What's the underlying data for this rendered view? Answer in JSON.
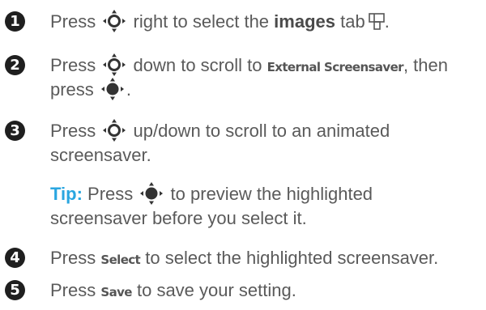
{
  "steps": [
    {
      "number": "1",
      "parts": {
        "a": "Press",
        "b": "right to select the",
        "c": "images",
        "d": "tab",
        "e": "."
      }
    },
    {
      "number": "2",
      "parts": {
        "a": "Press",
        "b": "down to scroll to",
        "c": "External Screensaver",
        "d": ", then",
        "e": "press",
        "f": "."
      }
    },
    {
      "number": "3",
      "parts": {
        "a": "Press",
        "b": "up/down to scroll to an animated",
        "c": "screensaver."
      }
    },
    {
      "number": "4",
      "parts": {
        "a": "Press",
        "b": "Select",
        "c": "to select the highlighted screensaver."
      }
    },
    {
      "number": "5",
      "parts": {
        "a": "Press",
        "b": "Save",
        "c": "to save your setting."
      }
    }
  ],
  "tip": {
    "label": "Tip:",
    "parts": {
      "a": "Press",
      "b": "to preview the highlighted",
      "c": "screensaver before you select it."
    }
  },
  "icons": {
    "nav_key": "navigation-key-icon",
    "center_key": "center-select-key-icon",
    "images_tab": "images-tab-icon"
  },
  "colors": {
    "tip_accent": "#2aa6e0",
    "badge": "#1f1f1f",
    "text": "#5a5a5a"
  }
}
